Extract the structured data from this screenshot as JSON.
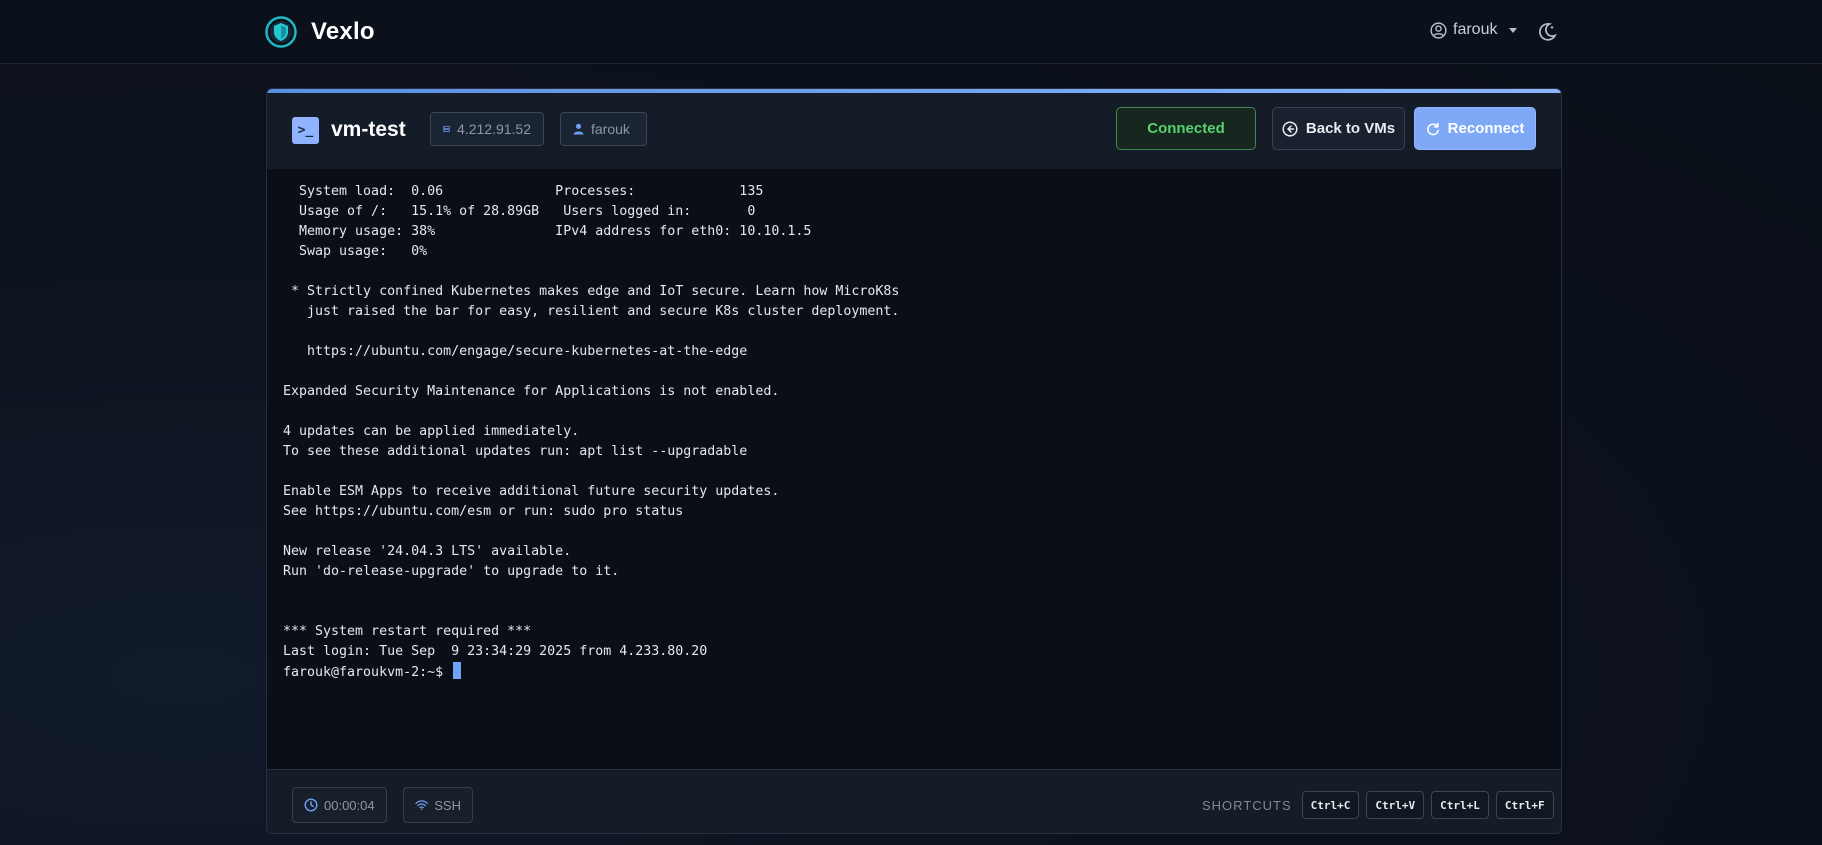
{
  "app": {
    "name": "Vexlo"
  },
  "user_menu": {
    "username": "farouk"
  },
  "vm": {
    "name": "vm-test",
    "ip": "4.212.91.52",
    "user": "farouk"
  },
  "actions": {
    "connected_label": "Connected",
    "back_label": "Back to VMs",
    "reconnect_label": "Reconnect"
  },
  "terminal": {
    "lines": [
      "  System load:  0.06              Processes:             135",
      "  Usage of /:   15.1% of 28.89GB   Users logged in:       0",
      "  Memory usage: 38%               IPv4 address for eth0: 10.10.1.5",
      "  Swap usage:   0%",
      "",
      " * Strictly confined Kubernetes makes edge and IoT secure. Learn how MicroK8s",
      "   just raised the bar for easy, resilient and secure K8s cluster deployment.",
      "",
      "   https://ubuntu.com/engage/secure-kubernetes-at-the-edge",
      "",
      "Expanded Security Maintenance for Applications is not enabled.",
      "",
      "4 updates can be applied immediately.",
      "To see these additional updates run: apt list --upgradable",
      "",
      "Enable ESM Apps to receive additional future security updates.",
      "See https://ubuntu.com/esm or run: sudo pro status",
      "",
      "New release '24.04.3 LTS' available.",
      "Run 'do-release-upgrade' to upgrade to it.",
      "",
      "",
      "*** System restart required ***",
      "Last login: Tue Sep  9 23:34:29 2025 from 4.233.80.20"
    ],
    "prompt": "farouk@faroukvm-2:~$ "
  },
  "footer": {
    "session_time": "00:00:04",
    "protocol": "SSH",
    "shortcuts_label": "SHORTCUTS",
    "shortcuts": [
      "Ctrl+C",
      "Ctrl+V",
      "Ctrl+L",
      "Ctrl+F"
    ]
  },
  "colors": {
    "accent": "#7fa9f7",
    "connected": "#54d36d",
    "background": "#0a0f17"
  }
}
